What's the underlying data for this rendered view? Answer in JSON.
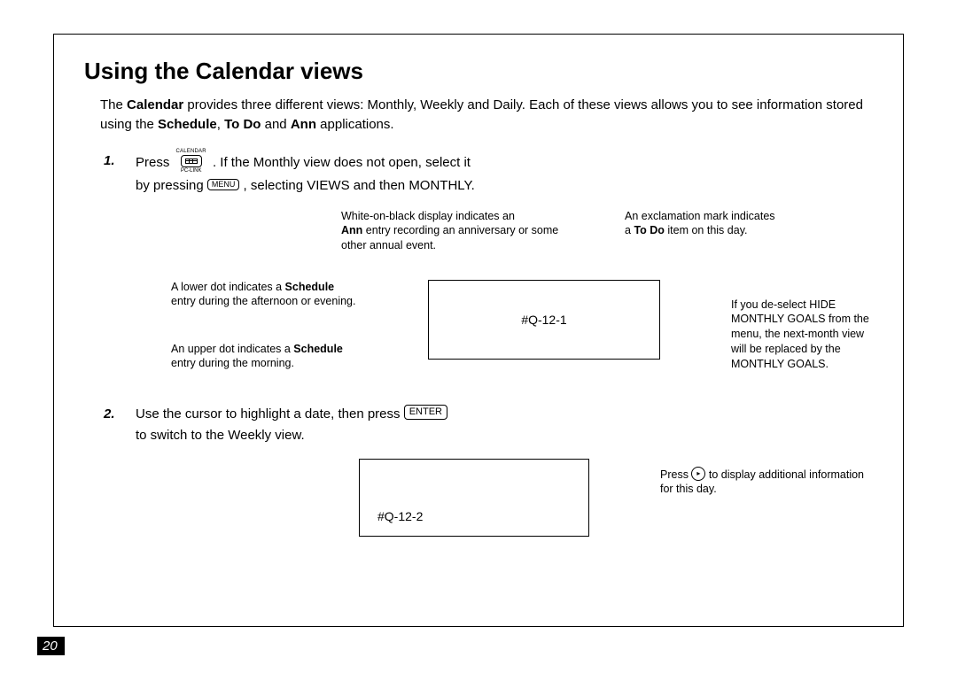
{
  "title": "Using the Calendar views",
  "intro": {
    "pre": "The ",
    "bold1": "Calendar",
    "mid1": " provides three different views: Monthly, Weekly and Daily. Each of these views allows you to see information stored using the ",
    "bold2": "Schedule",
    "sep1": ", ",
    "bold3": "To Do",
    "sep2": " and ",
    "bold4": "Ann",
    "tail": " applications."
  },
  "step1": {
    "number": "1.",
    "line1a": "Press ",
    "key_top": "CALENDAR",
    "key_bot": "PC-LINK",
    "line1b": ". If the Monthly view does not open, select it",
    "line2a": "by pressing ",
    "menu_label": "MENU",
    "line2b": ", selecting VIEWS and then MONTHLY."
  },
  "notes1": {
    "white_on_black": "White-on-black display indicates an",
    "ann_bold": "Ann",
    "white_on_black2": " entry recording an anniversary or some other annual event.",
    "excl1": "An exclamation mark indicates",
    "excl2a": "a ",
    "excl2_bold": "To Do",
    "excl2b": " item on this day.",
    "lower_dot1": "A lower dot indicates a ",
    "lower_dot_bold": "Schedule",
    "lower_dot2": "entry during the afternoon or evening.",
    "upper_dot1": "An upper dot indicates a ",
    "upper_dot_bold": "Schedule",
    "upper_dot2": "entry during the morning.",
    "hide_goals": "If you de-select HIDE MONTHLY GOALS from the menu, the next-month view will be replaced by the MONTHLY GOALS."
  },
  "placeholder1": "#Q-12-1",
  "step2": {
    "number": "2.",
    "line1a": "Use the cursor to highlight a date, then press ",
    "enter_label": "ENTER",
    "line2": "to switch to the Weekly view."
  },
  "placeholder2": "#Q-12-2",
  "notes2": {
    "press_a": "Press ",
    "arrow": "▸",
    "press_b": " to display additional information for this day."
  },
  "page_number": "20"
}
